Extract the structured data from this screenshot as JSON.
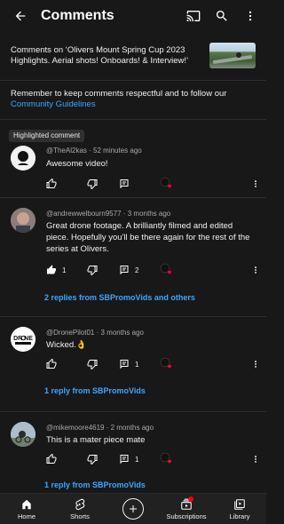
{
  "app_bar": {
    "title": "Comments",
    "icons": [
      "back-arrow-icon",
      "cast-icon",
      "search-icon",
      "more-vert-icon"
    ]
  },
  "video": {
    "title": "Comments on ‘Olivers Mount Spring Cup 2023 Highlights. Aerial shots! Onboards! & Interview!’"
  },
  "guidelines": {
    "text": "Remember to keep comments respectful and to follow our",
    "link": "Community Guidelines"
  },
  "comments": [
    {
      "highlight": "Highlighted comment",
      "author": "@TheAl2kas",
      "time": "52 minutes ago",
      "text": "Awesome video!",
      "likes": "",
      "replies_count": "",
      "replies_link": ""
    },
    {
      "highlight": "",
      "author": "@andrewwelbourn9577",
      "time": "3 months ago",
      "text": "Great drone footage. A brilliantly filmed and edited piece. Hopefully you'll be there again for the rest of the series at Olivers.",
      "likes": "1",
      "replies_count": "2",
      "replies_link": "2 replies from SBPromoVids and others"
    },
    {
      "highlight": "",
      "author": "@DronePilot01",
      "time": "3 months ago",
      "text": "Wicked.👌",
      "likes": "",
      "replies_count": "1",
      "replies_link": "1 reply from SBPromoVids"
    },
    {
      "highlight": "",
      "author": "@mikemoore4619",
      "time": "2 months ago",
      "text": "This is a mater piece mate",
      "likes": "",
      "replies_count": "1",
      "replies_link": "1 reply from SBPromoVids"
    }
  ],
  "bottom_nav": {
    "home": "Home",
    "shorts": "Shorts",
    "subscriptions": "Subscriptions",
    "library": "Library"
  },
  "colors": {
    "background": "#181818",
    "link": "#3ea6ff",
    "heart": "#ff0033",
    "notification": "#ff0000"
  }
}
